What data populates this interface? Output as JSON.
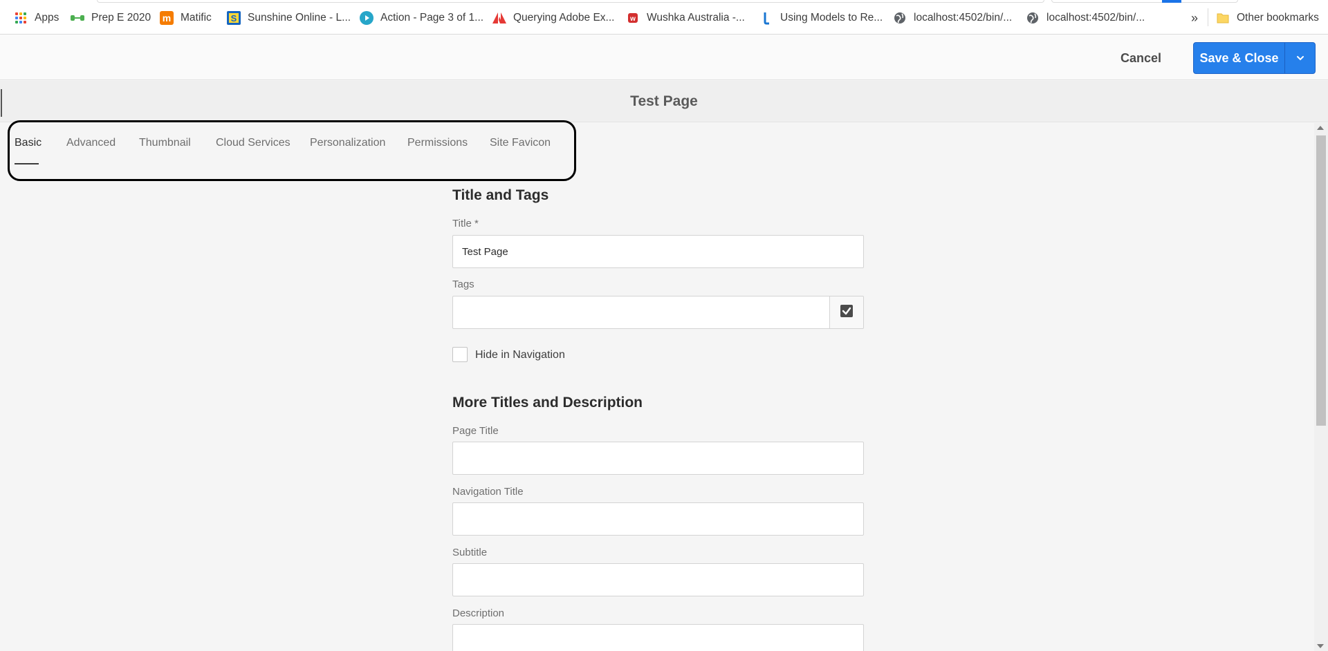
{
  "bookmarks": [
    {
      "label": "Apps",
      "icon": "apps-grid-icon"
    },
    {
      "label": "Prep E 2020",
      "icon": "prep-icon",
      "color": "#4caf50"
    },
    {
      "label": "Matific",
      "icon": "matific-icon",
      "color": "#f57c00"
    },
    {
      "label": "Sunshine Online - L...",
      "icon": "sunshine-icon",
      "color": "#1565c0"
    },
    {
      "label": "Action - Page 3 of 1...",
      "icon": "play-icon",
      "color": "#26a6c9"
    },
    {
      "label": "Querying Adobe Ex...",
      "icon": "adobe-icon",
      "color": "#e53935"
    },
    {
      "label": "Wushka Australia -...",
      "icon": "wushka-icon",
      "color": "#d32f2f"
    },
    {
      "label": "Using Models to Re...",
      "icon": "models-icon",
      "color": "#1976d2"
    },
    {
      "label": "localhost:4502/bin/...",
      "icon": "globe-icon"
    },
    {
      "label": "localhost:4502/bin/...",
      "icon": "globe-icon"
    }
  ],
  "bookmarks_overflow": "»",
  "other_bookmarks": "Other bookmarks",
  "toolbar": {
    "cancel_label": "Cancel",
    "save_label": "Save & Close",
    "accent": "#2680eb"
  },
  "page": {
    "title": "Test Page"
  },
  "tabs": [
    {
      "label": "Basic",
      "active": true
    },
    {
      "label": "Advanced"
    },
    {
      "label": "Thumbnail"
    },
    {
      "label": "Cloud Services"
    },
    {
      "label": "Personalization"
    },
    {
      "label": "Permissions"
    },
    {
      "label": "Site Favicon"
    }
  ],
  "form": {
    "section1_heading": "Title and Tags",
    "title_label": "Title *",
    "title_value": "Test Page",
    "tags_label": "Tags",
    "tags_value": "",
    "hide_nav_label": "Hide in Navigation",
    "hide_nav_checked": false,
    "section2_heading": "More Titles and Description",
    "page_title_label": "Page Title",
    "page_title_value": "",
    "nav_title_label": "Navigation Title",
    "nav_title_value": "",
    "subtitle_label": "Subtitle",
    "subtitle_value": "",
    "description_label": "Description",
    "description_value": ""
  }
}
